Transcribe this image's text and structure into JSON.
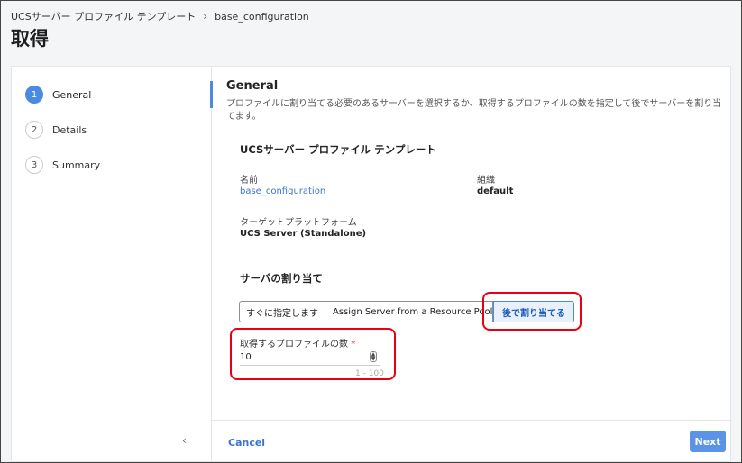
{
  "breadcrumb": {
    "parent": "UCSサーバー プロファイル テンプレート",
    "separator": "›",
    "current": "base_configuration"
  },
  "page_title": "取得",
  "steps": [
    {
      "num": "1",
      "label": "General",
      "active": true
    },
    {
      "num": "2",
      "label": "Details",
      "active": false
    },
    {
      "num": "3",
      "label": "Summary",
      "active": false
    }
  ],
  "collapse_icon": "‹",
  "general": {
    "title": "General",
    "description": "プロファイルに割り当てる必要のあるサーバーを選択するか、取得するプロファイルの数を指定して後でサーバーを割り当てます。",
    "template_section_title": "UCSサーバー プロファイル テンプレート",
    "name_label": "名前",
    "name_value": "base_configuration",
    "org_label": "組織",
    "org_value": "default",
    "platform_label": "ターゲットプラットフォーム",
    "platform_value": "UCS Server (Standalone)",
    "assign_title": "サーバの割り当て",
    "assign_options": [
      "すぐに指定します",
      "Assign Server from a Resource Pool",
      "後で割り当てる"
    ],
    "selected_option": "後で割り当てる",
    "count_label": "取得するプロファイルの数",
    "count_required_mark": "*",
    "count_value": "10",
    "count_range": "1 - 100"
  },
  "footer": {
    "cancel_label": "Cancel",
    "next_label": "Next"
  },
  "colors": {
    "accent": "#4a8ae0",
    "highlight": "#e60012"
  }
}
